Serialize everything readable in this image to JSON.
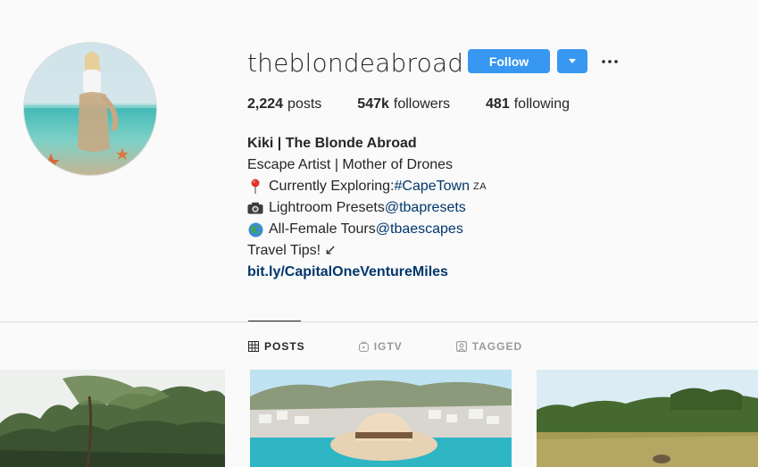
{
  "profile": {
    "username": "theblondeabroad",
    "verified": true,
    "follow_label": "Follow"
  },
  "stats": {
    "posts_count": "2,224",
    "posts_label": "posts",
    "followers_count": "547k",
    "followers_label": "followers",
    "following_count": "481",
    "following_label": "following"
  },
  "bio": {
    "name": "Kiki | The Blonde Abroad",
    "line1": "Escape Artist | Mother of Drones",
    "line2_text": "Currently Exploring: ",
    "line2_tag": "#CapeTown",
    "line2_suffix": "ZA",
    "line3_text": "Lightroom Presets ",
    "line3_tag": "@tbapresets",
    "line4_text": "All-Female Tours ",
    "line4_tag": "@tbaescapes",
    "line5": "Travel Tips! ↙",
    "link": "bit.ly/CapitalOneVentureMiles"
  },
  "tabs": [
    {
      "label": "POSTS",
      "icon": "grid-icon",
      "active": true
    },
    {
      "label": "IGTV",
      "icon": "igtv-icon",
      "active": false
    },
    {
      "label": "TAGGED",
      "icon": "tagged-icon",
      "active": false
    }
  ],
  "colors": {
    "accent": "#3897f0",
    "link": "#00376b",
    "background": "#fafafa"
  }
}
